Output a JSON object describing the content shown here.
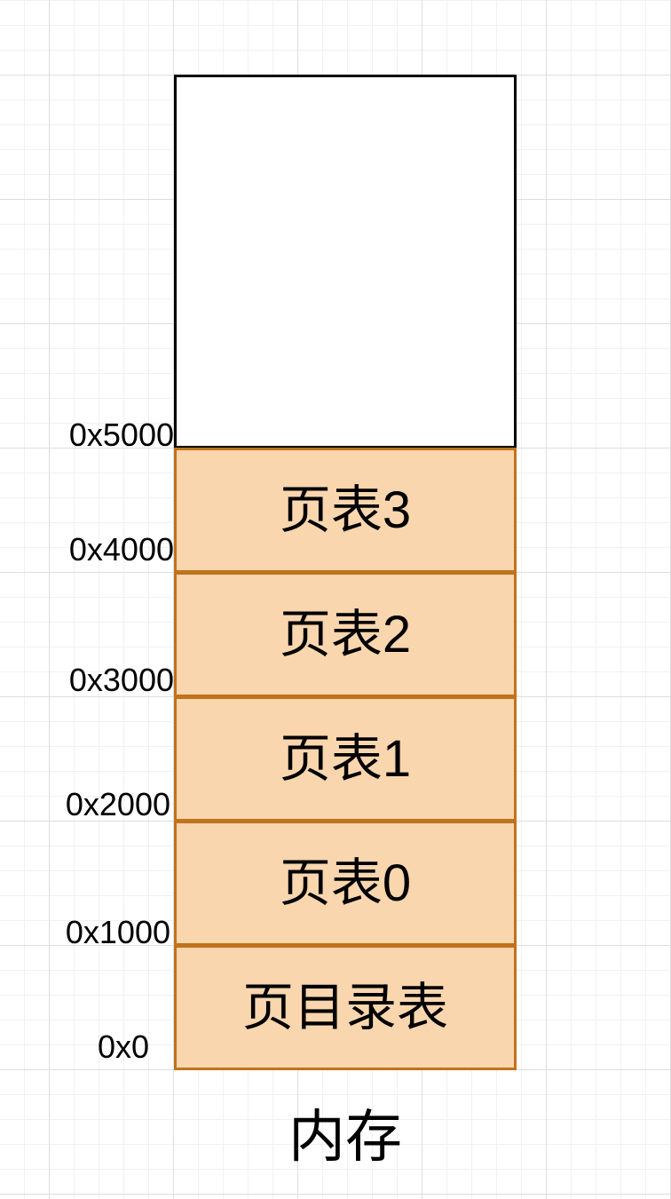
{
  "memory": {
    "label": "内存",
    "blocks": [
      {
        "label": "页目录表"
      },
      {
        "label": "页表0"
      },
      {
        "label": "页表1"
      },
      {
        "label": "页表2"
      },
      {
        "label": "页表3"
      }
    ],
    "addresses": [
      "0x0",
      "0x1000",
      "0x2000",
      "0x3000",
      "0x4000",
      "0x5000"
    ]
  },
  "colors": {
    "block_fill": "#f9d6ae",
    "block_border": "#c0721c",
    "empty_border": "#000000"
  }
}
